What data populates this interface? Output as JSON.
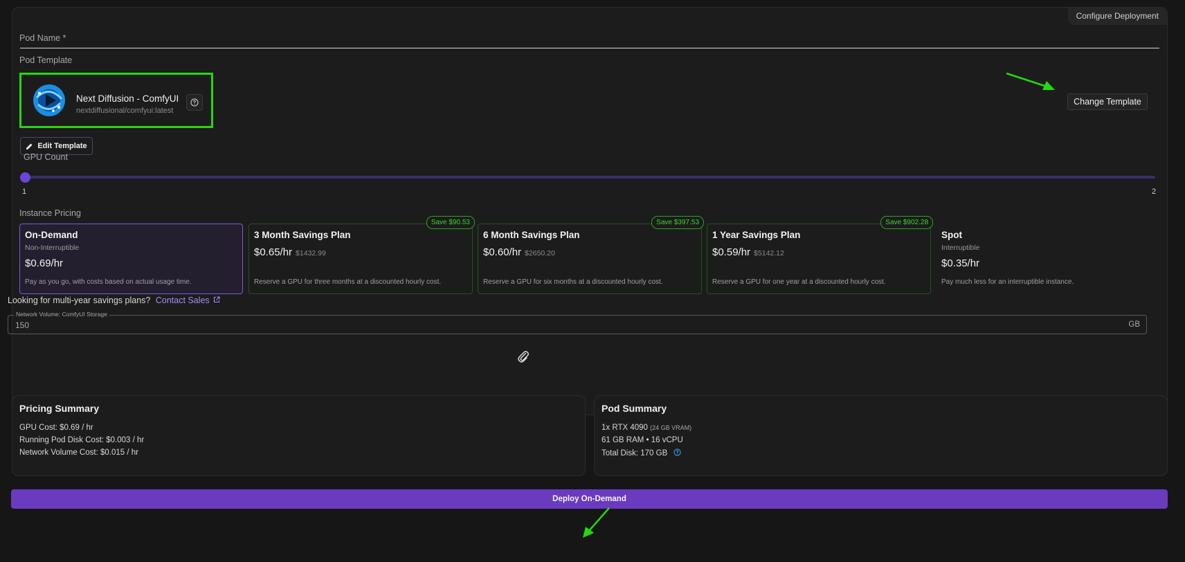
{
  "configure_tag": "Configure Deployment",
  "pod_name": {
    "label": "Pod Name *",
    "value": ""
  },
  "pod_template": {
    "label": "Pod Template",
    "name": "Next Diffusion - ComfyUI",
    "image": "nextdiffusional/comfyui:latest",
    "help_icon": "question-circle-icon",
    "change_button": "Change Template",
    "edit_button": "Edit Template",
    "edit_icon": "pencil-icon"
  },
  "gpu_count": {
    "label": "GPU Count",
    "value": 1,
    "min_label": "1",
    "max_label": "2"
  },
  "instance_pricing": {
    "label": "Instance Pricing",
    "plans": [
      {
        "title": "On-Demand",
        "subtitle": "Non-Interruptible",
        "price": "$0.69/hr",
        "original": "",
        "description": "Pay as you go, with costs based on actual usage time.",
        "badge": "",
        "selected": true
      },
      {
        "title": "3 Month Savings Plan",
        "subtitle": "",
        "price": "$0.65/hr",
        "original": "$1432.99",
        "description": "Reserve a GPU for three months at a discounted hourly cost.",
        "badge": "Save $90.53",
        "selected": false
      },
      {
        "title": "6 Month Savings Plan",
        "subtitle": "",
        "price": "$0.60/hr",
        "original": "$2650.20",
        "description": "Reserve a GPU for six months at a discounted hourly cost.",
        "badge": "Save $397.53",
        "selected": false
      },
      {
        "title": "1 Year Savings Plan",
        "subtitle": "",
        "price": "$0.59/hr",
        "original": "$5142.12",
        "description": "Reserve a GPU for one year at a discounted hourly cost.",
        "badge": "Save $902.28",
        "selected": false
      },
      {
        "title": "Spot",
        "subtitle": "Interruptible",
        "price": "$0.35/hr",
        "original": "",
        "description": "Pay much less for an interruptible instance.",
        "badge": "",
        "selected": false
      }
    ]
  },
  "multi_year": {
    "text": "Looking for multi-year savings plans?",
    "link": "Contact Sales"
  },
  "network_volume": {
    "label": "Network Volume: ComfyUI Storage",
    "value": "150",
    "unit": "GB"
  },
  "pricing_summary": {
    "title": "Pricing Summary",
    "lines": [
      "GPU Cost: $0.69 / hr",
      "Running Pod Disk Cost: $0.003 / hr",
      "Network Volume Cost: $0.015 / hr"
    ]
  },
  "pod_summary": {
    "title": "Pod Summary",
    "gpu": "1x RTX 4090",
    "gpu_vram": "(24 GB VRAM)",
    "resources": "61 GB RAM • 16 vCPU",
    "disk": "Total Disk: 170 GB"
  },
  "deploy_button": "Deploy On-Demand",
  "colors": {
    "accent": "#6a3abf",
    "highlight": "#27d80e",
    "save_badge": "#3fd22f",
    "link": "#a98cf8"
  }
}
